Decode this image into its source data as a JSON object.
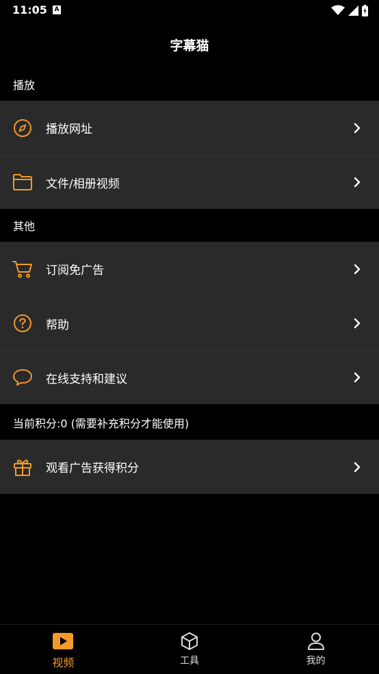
{
  "status": {
    "time": "11:05",
    "notif": "A"
  },
  "header": {
    "title": "字幕猫"
  },
  "sections": {
    "play": {
      "title": "播放"
    },
    "other": {
      "title": "其他"
    },
    "points": {
      "title": "当前积分:0 (需要补充积分才能使用)"
    }
  },
  "items": {
    "play_url": {
      "label": "播放网址",
      "icon": "compass-icon"
    },
    "file_video": {
      "label": "文件/相册视频",
      "icon": "folder-icon"
    },
    "subscribe": {
      "label": "订阅免广告",
      "icon": "cart-icon"
    },
    "help": {
      "label": "帮助",
      "icon": "question-icon"
    },
    "support": {
      "label": "在线支持和建议",
      "icon": "chat-bubble-icon"
    },
    "watch_ad": {
      "label": "观看广告获得积分",
      "icon": "gift-icon"
    }
  },
  "nav": {
    "video": {
      "label": "视频",
      "icon": "play-icon",
      "active": true
    },
    "tools": {
      "label": "工具",
      "icon": "cube-icon"
    },
    "mine": {
      "label": "我的",
      "icon": "user-icon"
    }
  },
  "colors": {
    "accent": "#f39a2b",
    "row_bg": "#2a2a2a",
    "bg": "#000000"
  }
}
